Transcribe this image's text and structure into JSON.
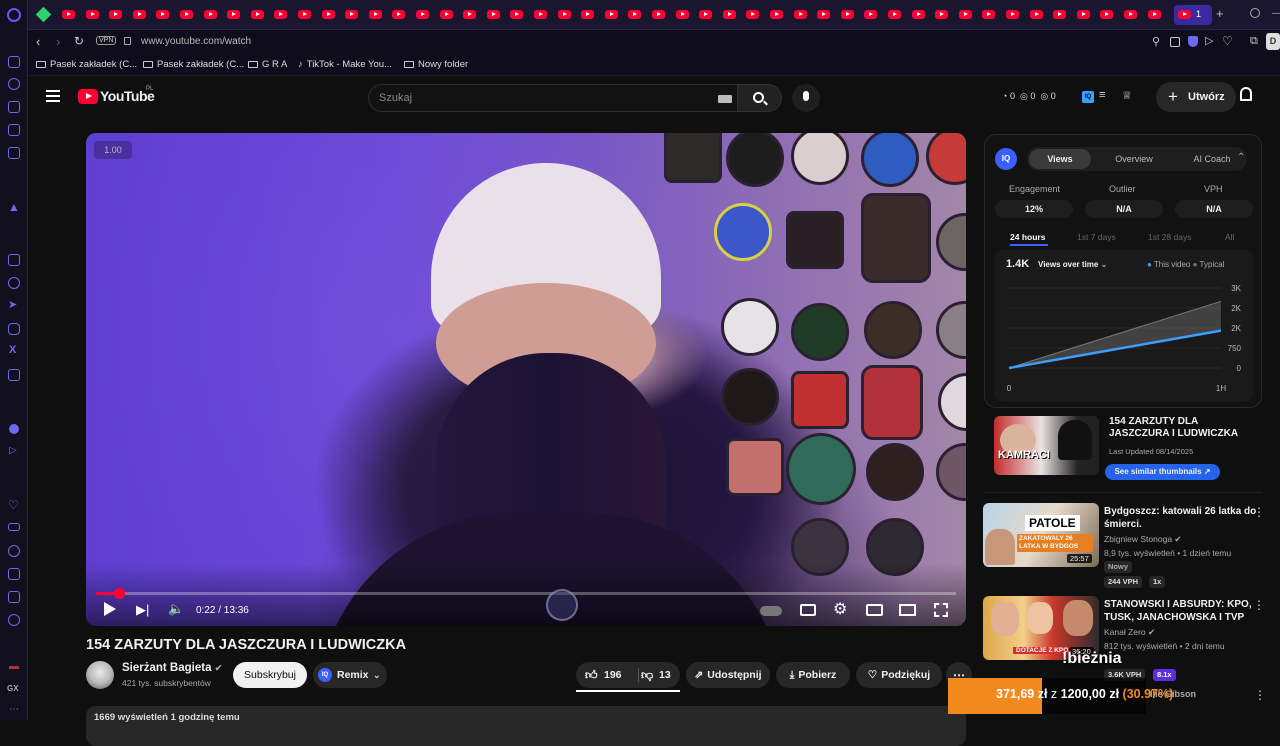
{
  "browser": {
    "url": "www.youtube.com/watch",
    "vpn_badge": "VPN",
    "active_tab_count": "1",
    "profile_initial": "D",
    "bookmarks": [
      "Pasek zakładek (C...",
      "Pasek zakładek (C...",
      "G R A",
      "TikTok - Make You...",
      "Nowy folder"
    ]
  },
  "youtube": {
    "logo_text": "YouTube",
    "region": "PL",
    "search_placeholder": "Szukaj",
    "header_counters": [
      "0",
      "0",
      "0"
    ],
    "create_label": "Utwórz",
    "iq_badge": "IQ"
  },
  "video": {
    "title": "154 ZARZUTY DLA JASZCZURA I LUDWICZKA",
    "speed_badge": "1.00",
    "time": "0:22 / 13:36",
    "progress": 0.027,
    "channel_name": "Sierżant Bagieta",
    "channel_subs": "421 tys. subskrybentów",
    "subscribe_label": "Subskrybuj",
    "remix_label": "Remix",
    "likes": "196",
    "dislikes": "13",
    "share_label": "Udostępnij",
    "download_label": "Pobierz",
    "thanks_label": "Podziękuj",
    "views_line": "1669 wyświetleń  1 godzinę temu"
  },
  "iq_panel": {
    "tabs": [
      "Views",
      "Overview",
      "AI Coach"
    ],
    "active_tab": "Views",
    "metrics": [
      {
        "label": "Engagement",
        "value": "12%"
      },
      {
        "label": "Outlier",
        "value": "N/A"
      },
      {
        "label": "VPH",
        "value": "N/A"
      }
    ],
    "ranges": [
      "24 hours",
      "1st 7 days",
      "1st 28 days",
      "All"
    ],
    "active_range": "24 hours",
    "views_total": "1.4K",
    "views_dropdown": "Views over time",
    "legend": [
      "This video",
      "Typical"
    ],
    "y_ticks": [
      "3K",
      "2K",
      "2K",
      "750",
      "0"
    ],
    "x_ticks": [
      "0",
      "1H"
    ],
    "video_card_title": "154 ZARZUTY DLA JASZCZURA I LUDWICZKA",
    "video_card_updated": "Last Updated 08/14/2025",
    "thumb_text": "KAMRACI",
    "similar_button": "See similar thumbnails"
  },
  "chart_data": {
    "type": "area",
    "x": [
      "0",
      "1H"
    ],
    "series": [
      {
        "name": "This video",
        "values": [
          0,
          1400
        ]
      },
      {
        "name": "Typical",
        "values": [
          0,
          2500
        ]
      }
    ],
    "y_tick_labels": [
      "0",
      "750",
      "2K",
      "2K",
      "3K"
    ],
    "x_tick_labels": [
      "0",
      "1H"
    ],
    "legend": "top-right"
  },
  "recommendations": [
    {
      "title": "Bydgoszcz: katowali 26 latka do śmierci.",
      "channel": "Zbigniew Stonoga",
      "meta": "8,9 tys. wyświetleń • 1 dzień temu",
      "badge": "Nowy",
      "vph": "244 VPH",
      "mult": "1x",
      "duration": "25:57",
      "thumb_text": "PATOLE",
      "thumb_text2": "ZAKATOWALY 26 LATKA W BYDGOS"
    },
    {
      "title": "STANOWSKI I ABSURDY: KPO, TUSK, JANACHOWSKA I TVP",
      "channel": "Kanał Zero",
      "meta": "812 tys. wyświetleń • 2 dni temu",
      "vph": "3.6K VPH",
      "mult": "8.1x",
      "duration": "36:20",
      "thumb_text": "DOTACJE Z KPO"
    }
  ],
  "overlay": {
    "ticker_text": "371,69 zł",
    "ticker_mid": "z",
    "ticker_target": "1200,00 zł",
    "ticker_pct": "(30.97%)",
    "caption": "!bieżnia",
    "third_partial": "Ilie Gibson"
  }
}
